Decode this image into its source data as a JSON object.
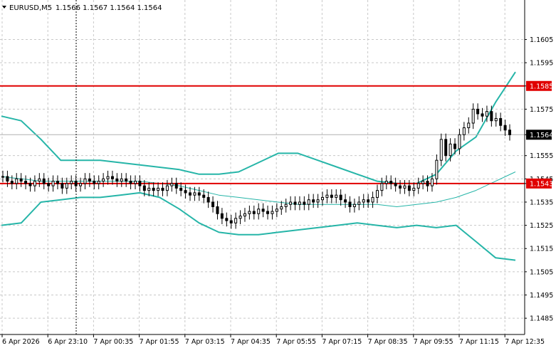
{
  "header": {
    "symbol": "EURUSD,M5",
    "ohlc": "1.1566 1.1567 1.1564 1.1564"
  },
  "colors": {
    "bollinger": "#26b5a8",
    "level_line": "#e00000",
    "grid": "#c8c8c8",
    "candle": "#000000",
    "price_tag_bg": "#000000",
    "level_tag_bg": "#e00000"
  },
  "icons": {
    "dropdown": "triangle-down-icon"
  },
  "price_tags": {
    "level_high": "1.1585",
    "current": "1.1564",
    "level_low": "1.1543"
  },
  "chart_data": {
    "type": "candlestick",
    "symbol": "EURUSD",
    "timeframe": "M5",
    "ylim": [
      1.1478,
      1.1622
    ],
    "y_ticks": [
      1.1605,
      1.1595,
      1.1585,
      1.1575,
      1.1564,
      1.1555,
      1.1545,
      1.1543,
      1.1535,
      1.1525,
      1.1515,
      1.1505,
      1.1495,
      1.1485
    ],
    "y_tick_labels": [
      "1.1605",
      "1.1595",
      "1.1585",
      "1.1575",
      "1.1564",
      "1.1555",
      "1.1545",
      "1.1543",
      "1.1535",
      "1.1525",
      "1.1515",
      "1.1505",
      "1.1495",
      "1.1485"
    ],
    "x_tick_labels": [
      "6 Apr 2026",
      "6 Apr 23:10",
      "7 Apr 00:35",
      "7 Apr 01:55",
      "7 Apr 03:15",
      "7 Apr 04:35",
      "7 Apr 05:55",
      "7 Apr 07:15",
      "7 Apr 08:35",
      "7 Apr 09:55",
      "7 Apr 11:15",
      "7 Apr 12:35"
    ],
    "horizontal_levels": [
      1.1585,
      1.1543
    ],
    "current_price": 1.1564,
    "grid": true,
    "close": [
      1.1546,
      1.1544,
      1.1543,
      1.1545,
      1.1544,
      1.1543,
      1.1542,
      1.1544,
      1.1545,
      1.1543,
      1.1542,
      1.1544,
      1.1543,
      1.1541,
      1.1543,
      1.1544,
      1.1542,
      1.1543,
      1.1545,
      1.1544,
      1.1543,
      1.1544,
      1.1545,
      1.1546,
      1.1545,
      1.1544,
      1.1545,
      1.1544,
      1.1543,
      1.1544,
      1.1542,
      1.154,
      1.1541,
      1.154,
      1.1541,
      1.154,
      1.1542,
      1.1543,
      1.1541,
      1.154,
      1.1539,
      1.1538,
      1.1539,
      1.1538,
      1.1537,
      1.1535,
      1.1533,
      1.153,
      1.1528,
      1.1527,
      1.1526,
      1.1528,
      1.1529,
      1.153,
      1.1531,
      1.153,
      1.1532,
      1.1531,
      1.153,
      1.1531,
      1.1532,
      1.1533,
      1.1534,
      1.1535,
      1.1534,
      1.1535,
      1.1534,
      1.1536,
      1.1535,
      1.1536,
      1.1537,
      1.1538,
      1.1537,
      1.1538,
      1.1536,
      1.1535,
      1.1533,
      1.1534,
      1.1535,
      1.1536,
      1.1535,
      1.1537,
      1.154,
      1.1543,
      1.1544,
      1.1543,
      1.1542,
      1.1541,
      1.1542,
      1.154,
      1.1541,
      1.1543,
      1.1544,
      1.1542,
      1.1545,
      1.1553,
      1.1562,
      1.1555,
      1.156,
      1.1558,
      1.1564,
      1.1567,
      1.1569,
      1.1575,
      1.1573,
      1.1572,
      1.1574,
      1.157,
      1.1571,
      1.1568,
      1.1566,
      1.1564
    ],
    "bollinger_upper": [
      1.1572,
      1.157,
      1.1562,
      1.1553,
      1.1553,
      1.1553,
      1.1552,
      1.1551,
      1.155,
      1.1549,
      1.1547,
      1.1547,
      1.1548,
      1.1552,
      1.1556,
      1.1556,
      1.1553,
      1.155,
      1.1547,
      1.1544,
      1.1543,
      1.1543,
      1.1547,
      1.1557,
      1.1563,
      1.1578,
      1.1591
    ],
    "bollinger_middle": [
      1.1546,
      1.1545,
      1.1544,
      1.1544,
      1.1544,
      1.1544,
      1.1544,
      1.1544,
      1.1543,
      1.1542,
      1.154,
      1.1538,
      1.1537,
      1.1536,
      1.1535,
      1.1534,
      1.1534,
      1.1534,
      1.1534,
      1.1534,
      1.1533,
      1.1534,
      1.1535,
      1.1537,
      1.154,
      1.1544,
      1.1548
    ],
    "bollinger_lower": [
      1.1525,
      1.1526,
      1.1535,
      1.1536,
      1.1537,
      1.1537,
      1.1538,
      1.1539,
      1.1537,
      1.1532,
      1.1526,
      1.1522,
      1.1521,
      1.1521,
      1.1522,
      1.1523,
      1.1524,
      1.1525,
      1.1526,
      1.1525,
      1.1524,
      1.1525,
      1.1524,
      1.1525,
      1.1518,
      1.1511,
      1.151
    ]
  }
}
